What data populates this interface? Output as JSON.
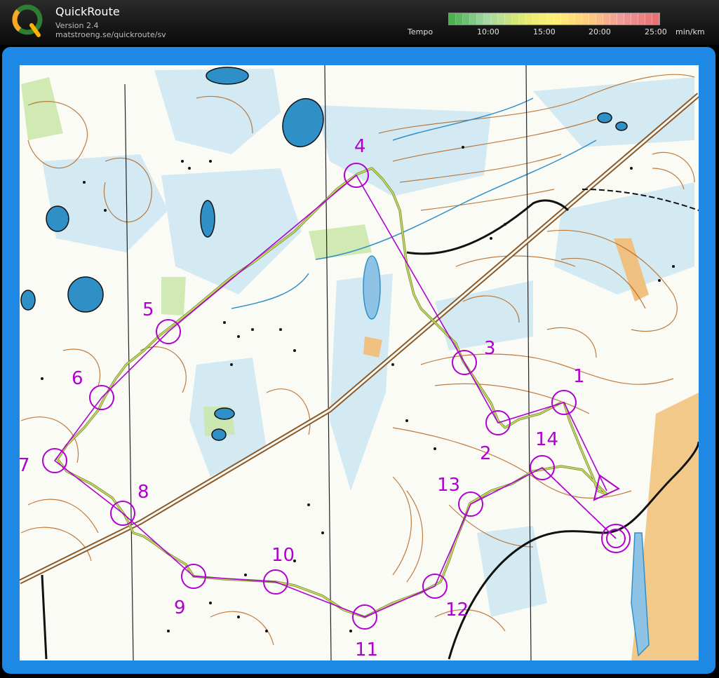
{
  "app": {
    "title": "QuickRoute",
    "version": "Version 2.4",
    "url": "matstroeng.se/quickroute/sv"
  },
  "tempo": {
    "label": "Tempo",
    "ticks": [
      "10:00",
      "15:00",
      "20:00",
      "25:00"
    ],
    "unit": "min/km",
    "colors": [
      "#4caf50",
      "#a5d6a7",
      "#dce775",
      "#fff176",
      "#ffcc80",
      "#ef9a9a",
      "#e57373"
    ]
  },
  "colors": {
    "course": "#b000d0",
    "route": "#7fa84a",
    "contour": "#b5651d",
    "water": "#2f8fc7",
    "frame": "#1e88e5"
  },
  "controls": [
    "1",
    "2",
    "3",
    "4",
    "5",
    "6",
    "7",
    "8",
    "9",
    "10",
    "11",
    "12",
    "13",
    "14"
  ]
}
